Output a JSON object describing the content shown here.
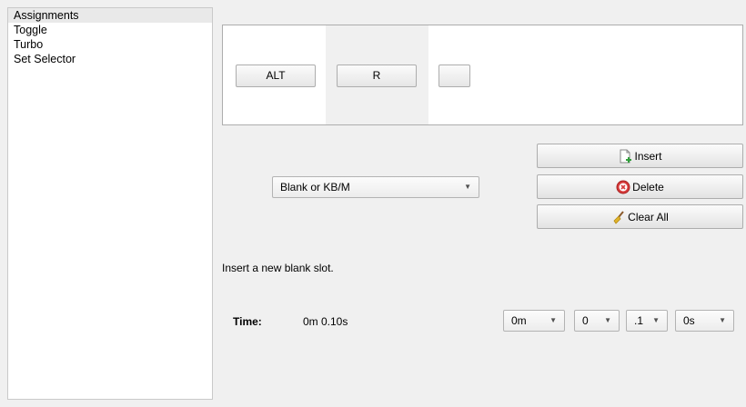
{
  "sidebar": {
    "items": [
      {
        "label": "Assignments"
      },
      {
        "label": "Toggle"
      },
      {
        "label": "Turbo"
      },
      {
        "label": "Set Selector"
      }
    ]
  },
  "slots": {
    "buttons": [
      {
        "label": "ALT"
      },
      {
        "label": "R"
      },
      {
        "label": ""
      }
    ]
  },
  "slot_type": {
    "selected": "Blank or KB/M"
  },
  "actions": {
    "insert_label": "Insert",
    "delete_label": "Delete",
    "clear_all_label": "Clear All"
  },
  "description": "Insert a new blank slot.",
  "time": {
    "label": "Time:",
    "value": "0m 0.10s",
    "minutes": "0m",
    "seconds": "0",
    "tenths": ".1",
    "extra": "0s"
  },
  "icons": {
    "insert": "document-add-icon",
    "delete": "delete-icon",
    "clear_all": "broom-icon",
    "dropdown": "chevron-down-icon"
  },
  "colors": {
    "delete_red": "#d63a3a",
    "insert_green": "#2f9e3a",
    "broom_yellow": "#e0b32a"
  }
}
